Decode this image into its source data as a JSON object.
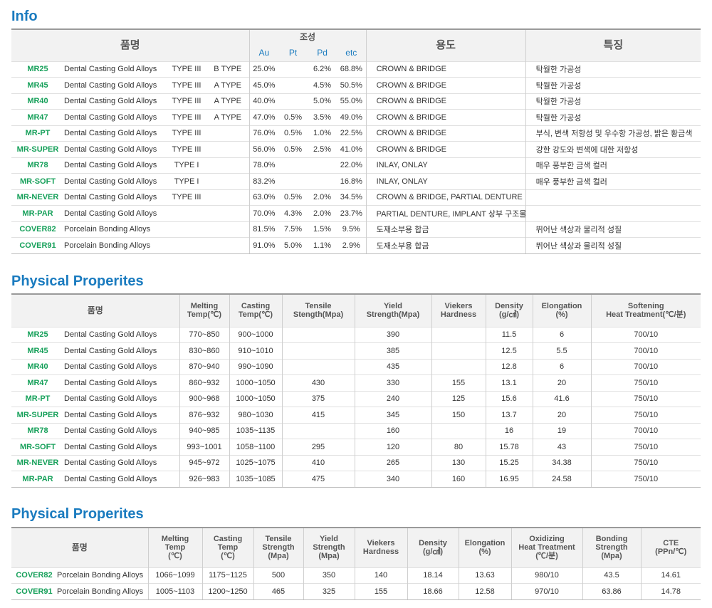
{
  "info": {
    "title": "Info",
    "header": {
      "name": "품명",
      "composition": "조성",
      "au": "Au",
      "pt": "Pt",
      "pd": "Pd",
      "etc": "etc",
      "usage": "용도",
      "feature": "특징"
    },
    "rows": [
      {
        "code": "MR25",
        "name": "Dental Casting Gold Alloys",
        "type": "TYPE III",
        "subtype": "B TYPE",
        "au": "25.0%",
        "pt": "",
        "pd": "6.2%",
        "etc": "68.8%",
        "usage": "CROWN & BRIDGE",
        "feature": "탁월한 가공성"
      },
      {
        "code": "MR45",
        "name": "Dental Casting Gold Alloys",
        "type": "TYPE III",
        "subtype": "A TYPE",
        "au": "45.0%",
        "pt": "",
        "pd": "4.5%",
        "etc": "50.5%",
        "usage": "CROWN & BRIDGE",
        "feature": "탁월한 가공성"
      },
      {
        "code": "MR40",
        "name": "Dental Casting Gold Alloys",
        "type": "TYPE III",
        "subtype": "A TYPE",
        "au": "40.0%",
        "pt": "",
        "pd": "5.0%",
        "etc": "55.0%",
        "usage": "CROWN & BRIDGE",
        "feature": "탁월한 가공성"
      },
      {
        "code": "MR47",
        "name": "Dental Casting Gold Alloys",
        "type": "TYPE III",
        "subtype": "A TYPE",
        "au": "47.0%",
        "pt": "0.5%",
        "pd": "3.5%",
        "etc": "49.0%",
        "usage": "CROWN & BRIDGE",
        "feature": "탁월한 가공성"
      },
      {
        "code": "MR-PT",
        "name": "Dental Casting Gold Alloys",
        "type": "TYPE III",
        "subtype": "",
        "au": "76.0%",
        "pt": "0.5%",
        "pd": "1.0%",
        "etc": "22.5%",
        "usage": "CROWN & BRIDGE",
        "feature": "부식, 변색 저항성 및 우수항 가공성, 밝은 황금색"
      },
      {
        "code": "MR-SUPER",
        "name": "Dental Casting Gold Alloys",
        "type": "TYPE III",
        "subtype": "",
        "au": "56.0%",
        "pt": "0.5%",
        "pd": "2.5%",
        "etc": "41.0%",
        "usage": "CROWN & BRIDGE",
        "feature": "강한 강도와 변색에 대한 저항성"
      },
      {
        "code": "MR78",
        "name": "Dental Casting Gold Alloys",
        "type": "TYPE I",
        "subtype": "",
        "au": "78.0%",
        "pt": "",
        "pd": "",
        "etc": "22.0%",
        "usage": "INLAY, ONLAY",
        "feature": "매우 풍부한 금색 컬러"
      },
      {
        "code": "MR-SOFT",
        "name": "Dental Casting Gold Alloys",
        "type": "TYPE I",
        "subtype": "",
        "au": "83.2%",
        "pt": "",
        "pd": "",
        "etc": "16.8%",
        "usage": "INLAY, ONLAY",
        "feature": "매우 풍부한 금색 컬러"
      },
      {
        "code": "MR-NEVER",
        "name": "Dental Casting Gold Alloys",
        "type": "TYPE III",
        "subtype": "",
        "au": "63.0%",
        "pt": "0.5%",
        "pd": "2.0%",
        "etc": "34.5%",
        "usage": "CROWN & BRIDGE, PARTIAL DENTURE",
        "feature": ""
      },
      {
        "code": "MR-PAR",
        "name": "Dental Casting Gold Alloys",
        "type": "",
        "subtype": "",
        "au": "70.0%",
        "pt": "4.3%",
        "pd": "2.0%",
        "etc": "23.7%",
        "usage": "PARTIAL DENTURE, IMPLANT 상부 구조물",
        "feature": ""
      },
      {
        "code": "COVER82",
        "name": "Porcelain Bonding Alloys",
        "type": "",
        "subtype": "",
        "au": "81.5%",
        "pt": "7.5%",
        "pd": "1.5%",
        "etc": "9.5%",
        "usage": "도재소부용 합금",
        "feature": "뛰어난 색상과 물리적 성질"
      },
      {
        "code": "COVER91",
        "name": "Porcelain Bonding Alloys",
        "type": "",
        "subtype": "",
        "au": "91.0%",
        "pt": "5.0%",
        "pd": "1.1%",
        "etc": "2.9%",
        "usage": "도재소부용 합금",
        "feature": "뛰어난 색상과 물리적 성질"
      }
    ]
  },
  "physical1": {
    "title": "Physical Properites",
    "header": {
      "name": "품명",
      "melting": [
        "Melting",
        "Temp(℃)"
      ],
      "casting": [
        "Casting",
        "Temp(℃)"
      ],
      "tensile": [
        "Tensile",
        "Stength(Mpa)"
      ],
      "yield": [
        "Yield",
        "Strength(Mpa)"
      ],
      "viekers": [
        "Viekers",
        "Hardness"
      ],
      "density": [
        "Density",
        "(g/㎤)"
      ],
      "elongation": [
        "Elongation",
        "(%)"
      ],
      "softening": [
        "Softening",
        "Heat Treatment(℃/분)"
      ]
    },
    "rows": [
      {
        "code": "MR25",
        "name": "Dental Casting Gold Alloys",
        "melting": "770~850",
        "casting": "900~1000",
        "tensile": "",
        "yield": "390",
        "viekers": "",
        "density": "11.5",
        "elongation": "6",
        "softening": "700/10"
      },
      {
        "code": "MR45",
        "name": "Dental Casting Gold Alloys",
        "melting": "830~860",
        "casting": "910~1010",
        "tensile": "",
        "yield": "385",
        "viekers": "",
        "density": "12.5",
        "elongation": "5.5",
        "softening": "700/10"
      },
      {
        "code": "MR40",
        "name": "Dental Casting Gold Alloys",
        "melting": "870~940",
        "casting": "990~1090",
        "tensile": "",
        "yield": "435",
        "viekers": "",
        "density": "12.8",
        "elongation": "6",
        "softening": "700/10"
      },
      {
        "code": "MR47",
        "name": "Dental Casting Gold Alloys",
        "melting": "860~932",
        "casting": "1000~1050",
        "tensile": "430",
        "yield": "330",
        "viekers": "155",
        "density": "13.1",
        "elongation": "20",
        "softening": "750/10"
      },
      {
        "code": "MR-PT",
        "name": "Dental Casting Gold Alloys",
        "melting": "900~968",
        "casting": "1000~1050",
        "tensile": "375",
        "yield": "240",
        "viekers": "125",
        "density": "15.6",
        "elongation": "41.6",
        "softening": "750/10"
      },
      {
        "code": "MR-SUPER",
        "name": "Dental Casting Gold Alloys",
        "melting": "876~932",
        "casting": "980~1030",
        "tensile": "415",
        "yield": "345",
        "viekers": "150",
        "density": "13.7",
        "elongation": "20",
        "softening": "750/10"
      },
      {
        "code": "MR78",
        "name": "Dental Casting Gold Alloys",
        "melting": "940~985",
        "casting": "1035~1135",
        "tensile": "",
        "yield": "160",
        "viekers": "",
        "density": "16",
        "elongation": "19",
        "softening": "700/10"
      },
      {
        "code": "MR-SOFT",
        "name": "Dental Casting Gold Alloys",
        "melting": "993~1001",
        "casting": "1058~1100",
        "tensile": "295",
        "yield": "120",
        "viekers": "80",
        "density": "15.78",
        "elongation": "43",
        "softening": "750/10"
      },
      {
        "code": "MR-NEVER",
        "name": "Dental Casting Gold Alloys",
        "melting": "945~972",
        "casting": "1025~1075",
        "tensile": "410",
        "yield": "265",
        "viekers": "130",
        "density": "15.25",
        "elongation": "34.38",
        "softening": "750/10"
      },
      {
        "code": "MR-PAR",
        "name": "Dental Casting Gold Alloys",
        "melting": "926~983",
        "casting": "1035~1085",
        "tensile": "475",
        "yield": "340",
        "viekers": "160",
        "density": "16.95",
        "elongation": "24.58",
        "softening": "750/10"
      }
    ]
  },
  "physical2": {
    "title": "Physical Properites",
    "header": {
      "name": "품명",
      "melting": [
        "Melting",
        "Temp",
        "(℃)"
      ],
      "casting": [
        "Casting",
        "Temp",
        "(℃)"
      ],
      "tensile": [
        "Tensile",
        "Strength",
        "(Mpa)"
      ],
      "yield": [
        "Yield",
        "Strength",
        "(Mpa)"
      ],
      "viekers": [
        "Viekers",
        "Hardness"
      ],
      "density": [
        "Density",
        "(g/㎤)"
      ],
      "elongation": [
        "Elongation",
        "(%)"
      ],
      "oxidizing": [
        "Oxidizing",
        "Heat Treatment",
        "(℃/분)"
      ],
      "bonding": [
        "Bonding",
        "Strength",
        "(Mpa)"
      ],
      "cte": [
        "CTE",
        "(PPn/℃)"
      ]
    },
    "rows": [
      {
        "code": "COVER82",
        "name": "Porcelain Bonding Alloys",
        "melting": "1066~1099",
        "casting": "1175~1125",
        "tensile": "500",
        "yield": "350",
        "viekers": "140",
        "density": "18.14",
        "elongation": "13.63",
        "oxidizing": "980/10",
        "bonding": "43.5",
        "cte": "14.61"
      },
      {
        "code": "COVER91",
        "name": "Porcelain Bonding Alloys",
        "melting": "1005~1103",
        "casting": "1200~1250",
        "tensile": "465",
        "yield": "325",
        "viekers": "155",
        "density": "18.66",
        "elongation": "12.58",
        "oxidizing": "970/10",
        "bonding": "63.86",
        "cte": "14.78"
      }
    ]
  },
  "colors": {
    "title_blue": "#1a7bbf",
    "code_green": "#16a05a",
    "header_bg": "#f2f2f2"
  }
}
